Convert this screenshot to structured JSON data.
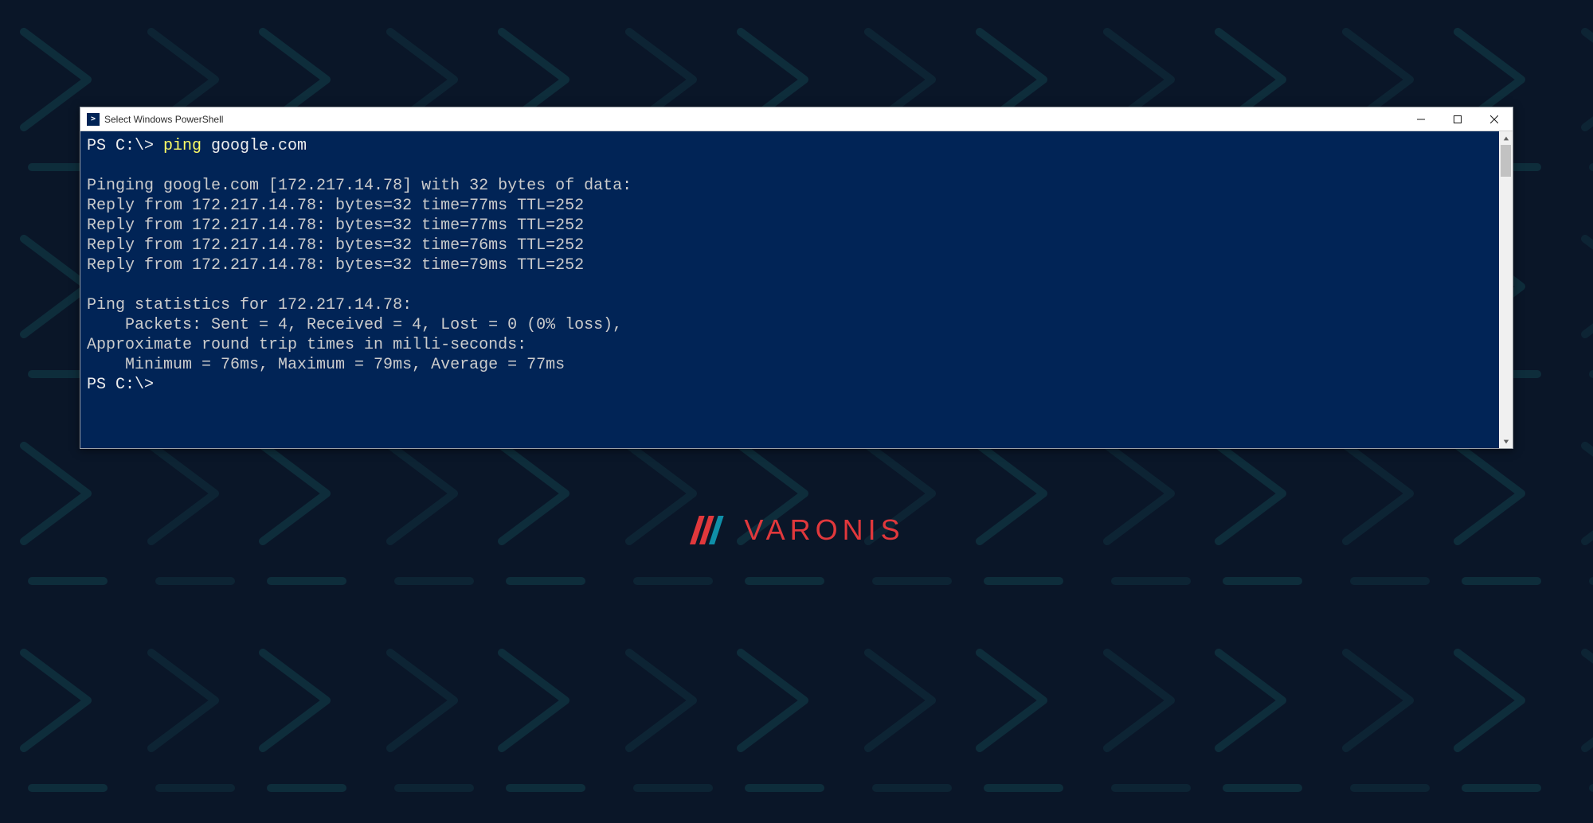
{
  "window": {
    "title": "Select Windows PowerShell"
  },
  "terminal": {
    "prompt1_prefix": "PS C:\\> ",
    "command_name": "ping",
    "command_arg": " google.com",
    "blank": "",
    "ping_header": "Pinging google.com [172.217.14.78] with 32 bytes of data:",
    "reply1": "Reply from 172.217.14.78: bytes=32 time=77ms TTL=252",
    "reply2": "Reply from 172.217.14.78: bytes=32 time=77ms TTL=252",
    "reply3": "Reply from 172.217.14.78: bytes=32 time=76ms TTL=252",
    "reply4": "Reply from 172.217.14.78: bytes=32 time=79ms TTL=252",
    "stats_header": "Ping statistics for 172.217.14.78:",
    "stats_packets": "    Packets: Sent = 4, Received = 4, Lost = 0 (0% loss),",
    "rtt_header": "Approximate round trip times in milli-seconds:",
    "rtt_values": "    Minimum = 76ms, Maximum = 79ms, Average = 77ms",
    "prompt2": "PS C:\\>"
  },
  "brand": {
    "name": "VARONIS"
  }
}
